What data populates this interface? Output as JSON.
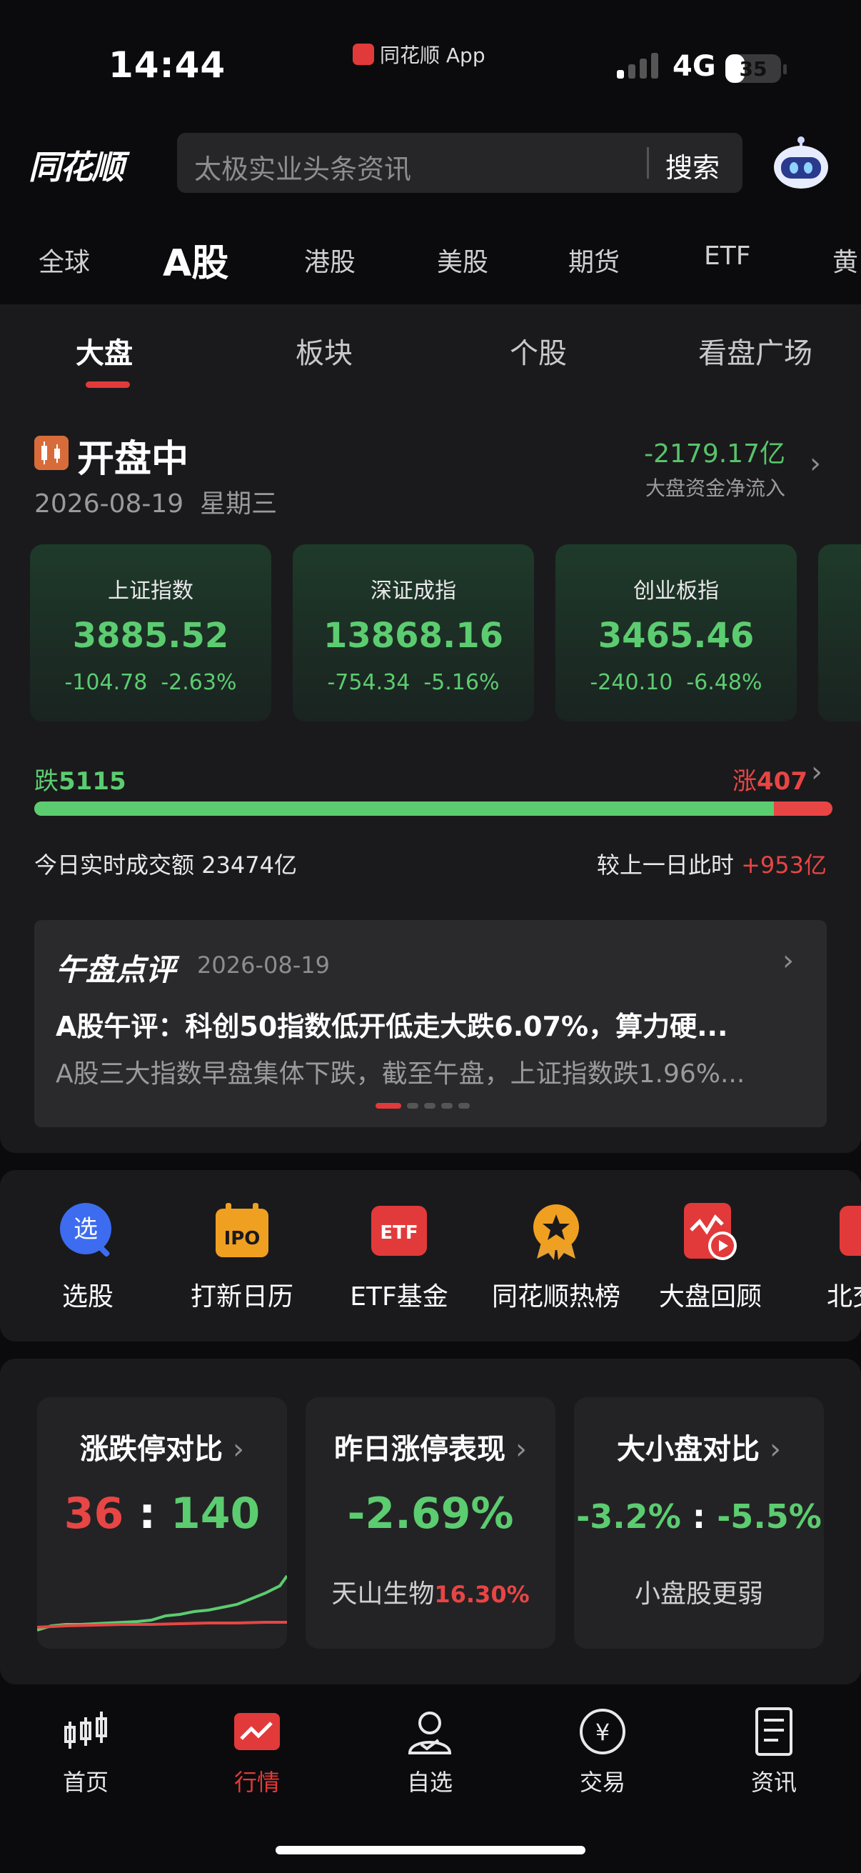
{
  "status_bar": {
    "time": "14:44",
    "carrier_app": "同花顺 App",
    "network": "4G",
    "battery": "35",
    "battery_level": 0.35
  },
  "header": {
    "logo": "同花顺",
    "search_placeholder": "太极实业头条资讯",
    "search_button": "搜索"
  },
  "market_tabs": [
    {
      "label": "全球"
    },
    {
      "label": "A股",
      "active": true
    },
    {
      "label": "港股"
    },
    {
      "label": "美股"
    },
    {
      "label": "期货"
    },
    {
      "label": "ETF"
    },
    {
      "label": "黄"
    }
  ],
  "sub_tabs": [
    {
      "label": "大盘",
      "active": true
    },
    {
      "label": "板块"
    },
    {
      "label": "个股"
    },
    {
      "label": "看盘广场"
    }
  ],
  "overview": {
    "state": "开盘中",
    "date": "2026-08-19",
    "weekday": "星期三",
    "net_flow_value": "-2179.17亿",
    "net_flow_label": "大盘资金净流入"
  },
  "indices": [
    {
      "name": "上证指数",
      "price": "3885.52",
      "change": "-104.78",
      "pct": "-2.63%"
    },
    {
      "name": "深证成指",
      "price": "13868.16",
      "change": "-754.34",
      "pct": "-5.16%"
    },
    {
      "name": "创业板指",
      "price": "3465.46",
      "change": "-240.10",
      "pct": "-6.48%"
    }
  ],
  "breadth": {
    "fall_label": "跌",
    "fall_count": "5115",
    "rise_label": "涨",
    "rise_count": "407"
  },
  "turnover": {
    "label": "今日实时成交额",
    "value": "23474亿",
    "compare_label": "较上一日此时",
    "compare_value": "+953亿"
  },
  "news": {
    "title": "午盘点评",
    "date": "2026-08-19",
    "headline": "A股午评：科创50指数低开低走大跌6.07%，算力硬...",
    "summary": "A股三大指数早盘集体下跌，截至午盘，上证指数跌1.96%..."
  },
  "tools": [
    {
      "label": "选股",
      "icon": "select-stock-icon"
    },
    {
      "label": "打新日历",
      "icon": "ipo-calendar-icon"
    },
    {
      "label": "ETF基金",
      "icon": "etf-icon"
    },
    {
      "label": "同花顺热榜",
      "icon": "hot-list-icon"
    },
    {
      "label": "大盘回顾",
      "icon": "market-review-icon"
    },
    {
      "label": "北交",
      "icon": "bse-icon"
    }
  ],
  "stats": {
    "limit_compare": {
      "title": "涨跌停对比",
      "up": "36",
      "sep": ":",
      "down": "140"
    },
    "yesterday_limit": {
      "title": "昨日涨停表现",
      "value": "-2.69%",
      "stock": "天山生物",
      "stock_pct": "16.30%"
    },
    "size_compare": {
      "title": "大小盘对比",
      "big": "-3.2%",
      "sep": ":",
      "small": "-5.5%",
      "desc": "小盘股更弱"
    }
  },
  "tabbar": [
    {
      "label": "首页",
      "icon": "candlestick-icon"
    },
    {
      "label": "行情",
      "icon": "market-chart-icon",
      "active": true
    },
    {
      "label": "自选",
      "icon": "person-icon"
    },
    {
      "label": "交易",
      "icon": "yuan-icon"
    },
    {
      "label": "资讯",
      "icon": "document-icon"
    }
  ],
  "colors": {
    "up": "#e84545",
    "down": "#5ccc70",
    "accent": "#e23a3a",
    "background": "#0b0b0d",
    "card": "#1a1a1c"
  }
}
